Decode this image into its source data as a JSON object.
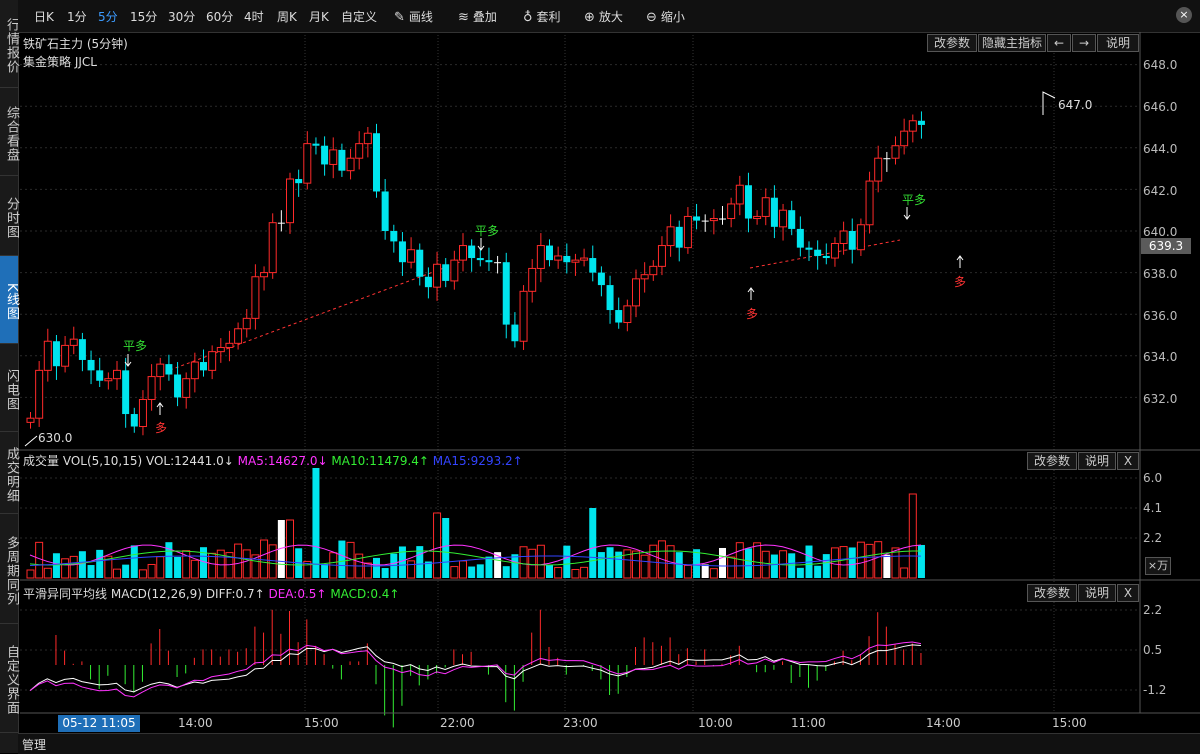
{
  "sidebar": {
    "items": [
      {
        "label": "行情报价",
        "active": false
      },
      {
        "label": "综合看盘",
        "active": false
      },
      {
        "label": "分时图",
        "active": false
      },
      {
        "label": "K线图",
        "active": true
      },
      {
        "label": "闪电图",
        "active": false
      },
      {
        "label": "成交明细",
        "active": false
      },
      {
        "label": "多周期同列",
        "active": false
      },
      {
        "label": "自定义界面",
        "active": false
      }
    ]
  },
  "toolbar": {
    "periods": [
      {
        "label": "日K",
        "active": false
      },
      {
        "label": "1分",
        "active": false
      },
      {
        "label": "5分",
        "active": true
      },
      {
        "label": "15分",
        "active": false
      },
      {
        "label": "30分",
        "active": false
      },
      {
        "label": "60分",
        "active": false
      },
      {
        "label": "4时",
        "active": false
      },
      {
        "label": "周K",
        "active": false
      },
      {
        "label": "月K",
        "active": false
      },
      {
        "label": "自定义",
        "active": false
      }
    ],
    "tools": [
      {
        "label": "画线",
        "icon": "pencil-icon",
        "glyph": "✎"
      },
      {
        "label": "叠加",
        "icon": "stack-icon",
        "glyph": "≋"
      },
      {
        "label": "套利",
        "icon": "moneybag-icon",
        "glyph": "♁"
      },
      {
        "label": "放大",
        "icon": "zoom-in-icon",
        "glyph": "⊕"
      },
      {
        "label": "缩小",
        "icon": "zoom-out-icon",
        "glyph": "⊖"
      }
    ],
    "close_glyph": "×"
  },
  "main_chart": {
    "title": "铁矿石主力 (5分钟)",
    "strategy": "集金策略 JJCL",
    "btn_params": "改参数",
    "btn_hide": "隐藏主指标",
    "btn_left": "←",
    "btn_right": "→",
    "btn_help": "说明",
    "y_ticks": [
      "648.0",
      "646.0",
      "644.0",
      "642.0",
      "640.0",
      "638.0",
      "636.0",
      "634.0",
      "632.0"
    ],
    "current_price": "639.3",
    "high_label": "647.0",
    "low_label": "630.0",
    "signals": [
      {
        "text": "平多",
        "color": "#33dd33"
      },
      {
        "text": "多",
        "color": "#ff3333"
      },
      {
        "text": "平多",
        "color": "#33dd33"
      },
      {
        "text": "多",
        "color": "#ff3333"
      },
      {
        "text": "平多",
        "color": "#33dd33"
      },
      {
        "text": "多",
        "color": "#ff3333"
      }
    ]
  },
  "volume": {
    "label": "成交量",
    "indicator": "VOL(5,10,15)",
    "vol": "VOL:12441.0↓",
    "ma5": "MA5:14627.0↓",
    "ma10": "MA10:11479.4↑",
    "ma15": "MA15:9293.2↑",
    "btn_params": "改参数",
    "btn_help": "说明",
    "btn_close": "X",
    "y_ticks": [
      "6.0",
      "4.1",
      "2.2"
    ],
    "unit": "×万"
  },
  "macd": {
    "label": "平滑异同平均线",
    "indicator": "MACD(12,26,9)",
    "diff": "DIFF:0.7↑",
    "dea": "DEA:0.5↑",
    "macd": "MACD:0.4↑",
    "btn_params": "改参数",
    "btn_help": "说明",
    "btn_close": "X",
    "y_ticks": [
      "2.2",
      "0.5",
      "-1.2"
    ]
  },
  "x_axis": {
    "selected": "05-12 11:05",
    "labels": [
      "14:00",
      "15:00",
      "22:00",
      "23:00",
      "10:00",
      "11:00",
      "14:00",
      "15:00"
    ]
  },
  "bottom": {
    "manage": "管理"
  },
  "colors": {
    "up": "#ff2a2a",
    "down": "#00e5ee",
    "flat": "#ffffff",
    "accent": "#1f6fb8"
  }
}
